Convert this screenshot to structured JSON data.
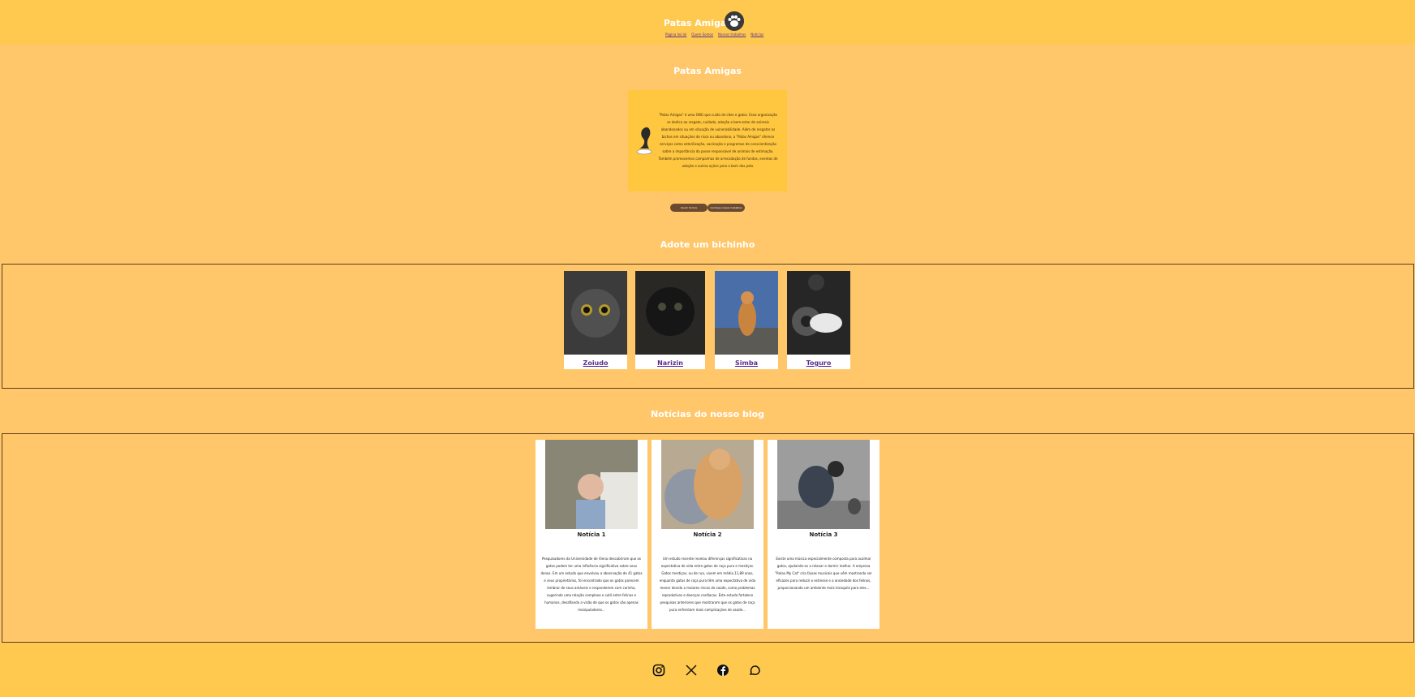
{
  "header": {
    "brand": "Patas Amigas",
    "nav": [
      "Página Inicial",
      "Quem Somos",
      "Nossos trabalhos",
      "Notícias"
    ],
    "icon": "paw-icon"
  },
  "about": {
    "title": "Patas Amigas",
    "text": "\"Patas Amigas\" é uma ONG que cuida de cães e gatos. Essa organização se dedica ao resgate, cuidado, adoção e bem-estar de animais abandonados ou em situação de vulnerabilidade. Além de resgatar os bichos em situações de risco ou abandono, a \"Patas Amigas\" oferece serviços como esterilização, vacinação e programas de conscientização sobre a importância da posse responsável de animais de estimação. Também promovemos campanhas de arrecadação de fundos, eventos de adoção e outras ações para o bem dos pets.",
    "buttons": [
      "Quem Somos",
      "Conheça nossos trabalhos"
    ]
  },
  "adopt": {
    "title": "Adote um bichinho",
    "pets": [
      {
        "name": "Zoiudo"
      },
      {
        "name": "Narizin"
      },
      {
        "name": "Simba"
      },
      {
        "name": "Toguro"
      }
    ]
  },
  "blog": {
    "title": "Notícias do nosso blog",
    "posts": [
      {
        "title": "Notícia 1",
        "text": "Pesquisadores da Universidade de Viena descobriram que os gatos podem ter uma influência significativa sobre seus donos. Em um estudo que envolveu a observação de 41 gatos e seus proprietários, foi encontrado que os gatos parecem lembrar de seus amáveis e responderem com carinho, sugerindo uma relação complexa e sutil entre felinos e humanos, desafiando a visão de que os gatos são apenas manipuladores..."
      },
      {
        "title": "Notícia 2",
        "text": "Um estudo recente revelou diferenças significativas na expectativa de vida entre gatos de raça pura e mestiços. Gatos mestiços, ou de rua, vivem em média 11,89 anos, enquanto gatos de raça pura têm uma expectativa de vida menor devido a maiores riscos de saúde, como problemas reprodutivos e doenças cardíacas. Este estudo fortalece pesquisas anteriores que mostraram que os gatos de raça pura enfrentam mais complicações de saúde..."
      },
      {
        "title": "Notícia 3",
        "text": "Existe uma música especialmente composta para acalmar gatos, ajudando-os a relaxar e dormir melhor. A empresa \"Relax My Cat\" cria faixas musicais que vêm mostrando ser eficazes para reduzir o estresse e a ansiedade dos felinos, proporcionando um ambiente mais tranquilo para eles..."
      }
    ]
  },
  "footer": {
    "icons": [
      "instagram-icon",
      "x-icon",
      "facebook-icon",
      "whatsapp-icon"
    ]
  }
}
